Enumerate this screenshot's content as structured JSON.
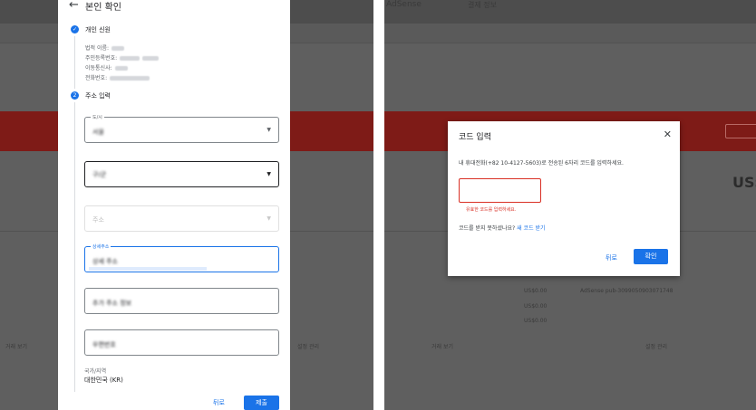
{
  "left": {
    "title": "본인 확인",
    "step1": {
      "label": "개인 신원",
      "lines": [
        "법적 이름:",
        "주민등록번호:",
        "이동통신사:",
        "전화번호:"
      ]
    },
    "step2": {
      "number": "2",
      "label": "주소 입력"
    },
    "fields": {
      "city_label": "도/시",
      "city_value": "서울",
      "district_value": "구/군",
      "address_placeholder": "주소",
      "detail_label": "상세주소",
      "detail_value": "상세 주소",
      "line2_value": "추가 주소 정보",
      "postal_value": "우편번호"
    },
    "country_label": "국가/지역",
    "country_value": "대한민국 (KR)",
    "back_button": "뒤로",
    "submit_button": "제출"
  },
  "right": {
    "background_title": "AdSense",
    "modal": {
      "title": "코드 입력",
      "description": "내 휴대전화(+82 10-4127-5603)로 전송된 6자리 코드를 입력하세요.",
      "error": "유효한 코드를 입력하세요.",
      "resend_question": "코드를 받지 못하셨나요?",
      "resend_link": "새 코드 받기",
      "back_button": "뒤로",
      "ok_button": "확인"
    }
  },
  "background": {
    "us_dollar": "US$",
    "amounts": [
      "US$0.00",
      "US$0.00",
      "US$0.00"
    ],
    "publisher": "AdSense pub-3099050903071748",
    "view_history": "거래 보기",
    "manage_settings": "설정 관리",
    "pay_info": "결제 정보"
  },
  "colors": {
    "primary_blue": "#1a73e8",
    "error_red": "#d93025",
    "overlay_gray": "#5f5f5f",
    "alert_red": "#7e1b17"
  }
}
